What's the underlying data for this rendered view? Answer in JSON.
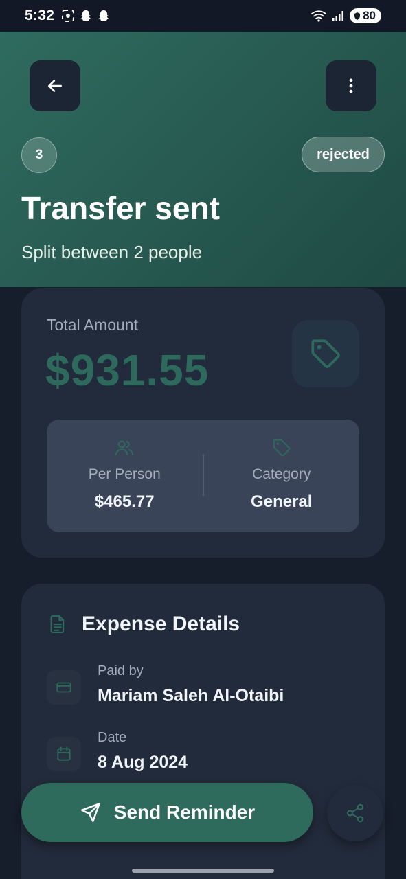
{
  "status_bar": {
    "time": "5:32",
    "battery": "80"
  },
  "header": {
    "count": "3",
    "status": "rejected",
    "title": "Transfer sent",
    "subtitle": "Split between 2 people"
  },
  "amount_card": {
    "label": "Total Amount",
    "value": "$931.55",
    "per_person_label": "Per Person",
    "per_person_value": "$465.77",
    "category_label": "Category",
    "category_value": "General"
  },
  "details": {
    "title": "Expense Details",
    "paid_by_label": "Paid by",
    "paid_by_value": "Mariam Saleh Al-Otaibi",
    "date_label": "Date",
    "date_value": "8 Aug 2024"
  },
  "actions": {
    "reminder_label": "Send Reminder"
  },
  "icons": {
    "back": "arrow-left-icon",
    "more": "more-vertical-icon",
    "tag": "tag-icon",
    "users": "users-icon",
    "document": "document-icon",
    "card": "credit-card-icon",
    "calendar": "calendar-icon",
    "send": "send-icon",
    "share": "share-icon"
  },
  "colors": {
    "accent": "#2e6b5c",
    "header_gradient_start": "#2f6b5e",
    "header_gradient_end": "#1f4a44",
    "card_bg": "#222b3b",
    "page_bg": "#161d2b"
  }
}
